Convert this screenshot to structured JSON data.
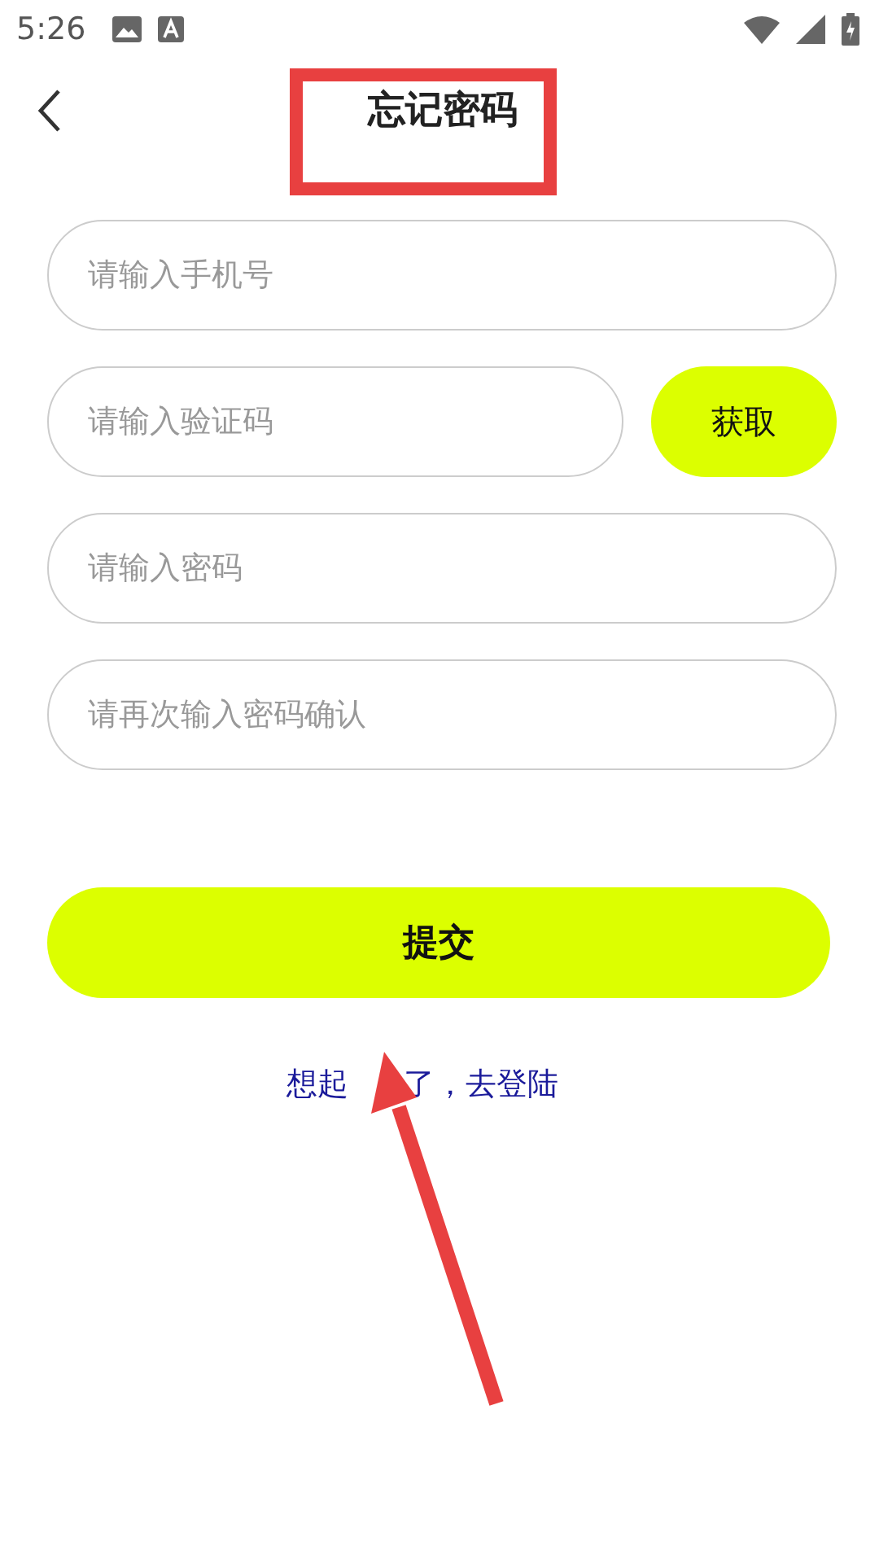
{
  "status_bar": {
    "time": "5:26"
  },
  "header": {
    "title": "忘记密码"
  },
  "form": {
    "phone": {
      "placeholder": "请输入手机号"
    },
    "code": {
      "placeholder": "请输入验证码",
      "button": "获取"
    },
    "password": {
      "placeholder": "请输入密码"
    },
    "confirm": {
      "placeholder": "请再次输入密码确认"
    },
    "submit": "提交",
    "login_link": [
      "想起",
      "了，去登陆"
    ]
  },
  "annotations": {
    "highlight_box": true,
    "arrow": true
  }
}
